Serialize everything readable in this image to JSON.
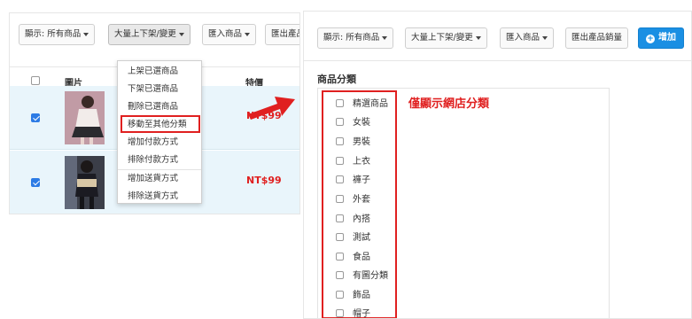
{
  "left": {
    "toolbar": {
      "display_filter": "顯示: 所有商品",
      "bulk_action": "大量上下架/變更",
      "import": "匯入商品",
      "export_truncated": "匯出產品"
    },
    "columns": {
      "image": "圖片",
      "price": "特價"
    },
    "products": [
      {
        "checked": true,
        "price": "NT$99"
      },
      {
        "checked": true,
        "price": "NT$99"
      }
    ],
    "menu": [
      "上架已選商品",
      "下架已選商品",
      "刪除已選商品",
      "移動至其他分類",
      "增加付款方式",
      "排除付款方式",
      "增加送貨方式",
      "排除送貨方式"
    ],
    "highlighted_menu_item": "移動至其他分類"
  },
  "right": {
    "toolbar": {
      "display_filter": "顯示: 所有商品",
      "bulk_action": "大量上下架/變更",
      "import": "匯入商品",
      "export": "匯出產品銷量",
      "add": "增加"
    },
    "category_title": "商品分類",
    "categories": [
      "精選商品",
      "女裝",
      "男裝",
      "上衣",
      "褲子",
      "外套",
      "內搭",
      "測試",
      "食品",
      "有圖分類",
      "飾品",
      "帽子"
    ],
    "annotation": "僅顯示網店分類"
  },
  "colors": {
    "highlight": "#e02020",
    "primary": "#1a8fe3",
    "selected_row": "#e9f5fb"
  }
}
